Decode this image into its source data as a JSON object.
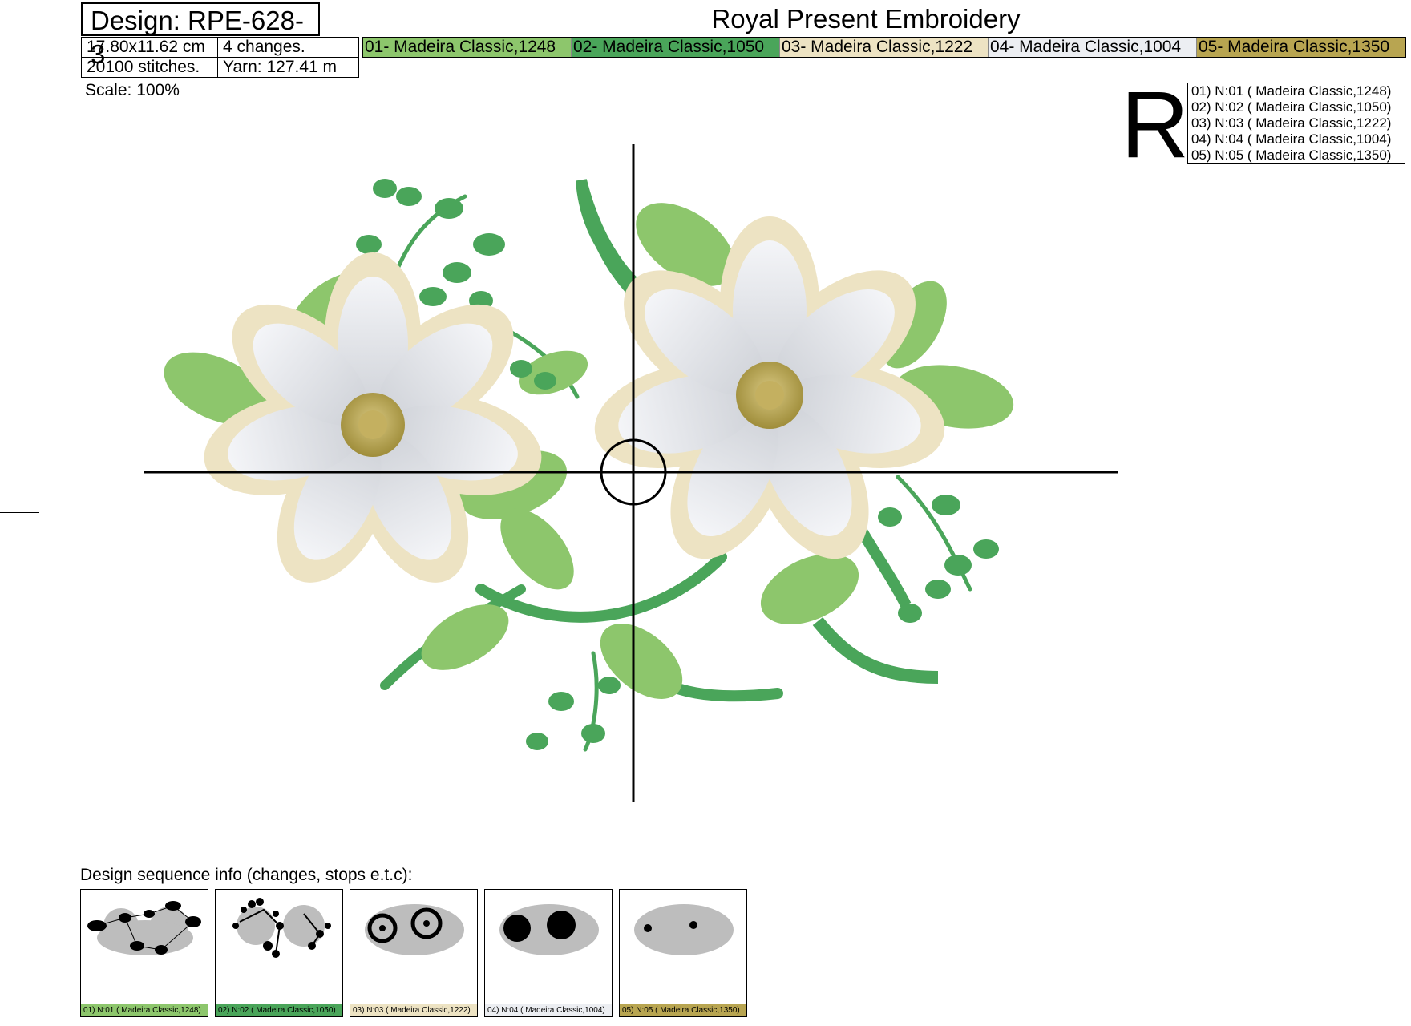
{
  "design": {
    "label": "Design: RPE-628-3"
  },
  "title": "Royal Present Embroidery",
  "info": {
    "size": "17.80x11.62 cm",
    "changes": "4 changes.",
    "stitches": "20100 stitches.",
    "yarn": "Yarn: 127.41 m"
  },
  "colors": [
    {
      "label": "01- Madeira Classic,1248",
      "hex": "#8dc66c"
    },
    {
      "label": "02- Madeira Classic,1050",
      "hex": "#4aa55a"
    },
    {
      "label": "03- Madeira Classic,1222",
      "hex": "#ede3c3"
    },
    {
      "label": "04- Madeira Classic,1004",
      "hex": "#eceef2"
    },
    {
      "label": "05- Madeira Classic,1350",
      "hex": "#b8a551"
    }
  ],
  "scale": "Scale: 100%",
  "orientation_letter": "R",
  "legend": [
    "01) N:01 ( Madeira Classic,1248)",
    "02) N:02 ( Madeira Classic,1050)",
    "03) N:03 ( Madeira Classic,1222)",
    "04) N:04 ( Madeira Classic,1004)",
    "05) N:05 ( Madeira Classic,1350)"
  ],
  "sequence": {
    "label": "Design sequence info (changes, stops e.t.c):",
    "steps": [
      {
        "label": "01) N:01 ( Madeira Classic,1248)",
        "hex": "#8dc66c"
      },
      {
        "label": "02) N:02 ( Madeira Classic,1050)",
        "hex": "#4aa55a"
      },
      {
        "label": "03) N:03 ( Madeira Classic,1222)",
        "hex": "#ede3c3"
      },
      {
        "label": "04) N:04 ( Madeira Classic,1004)",
        "hex": "#eceef2"
      },
      {
        "label": "05) N:05 ( Madeira Classic,1350)",
        "hex": "#b8a551"
      }
    ]
  }
}
